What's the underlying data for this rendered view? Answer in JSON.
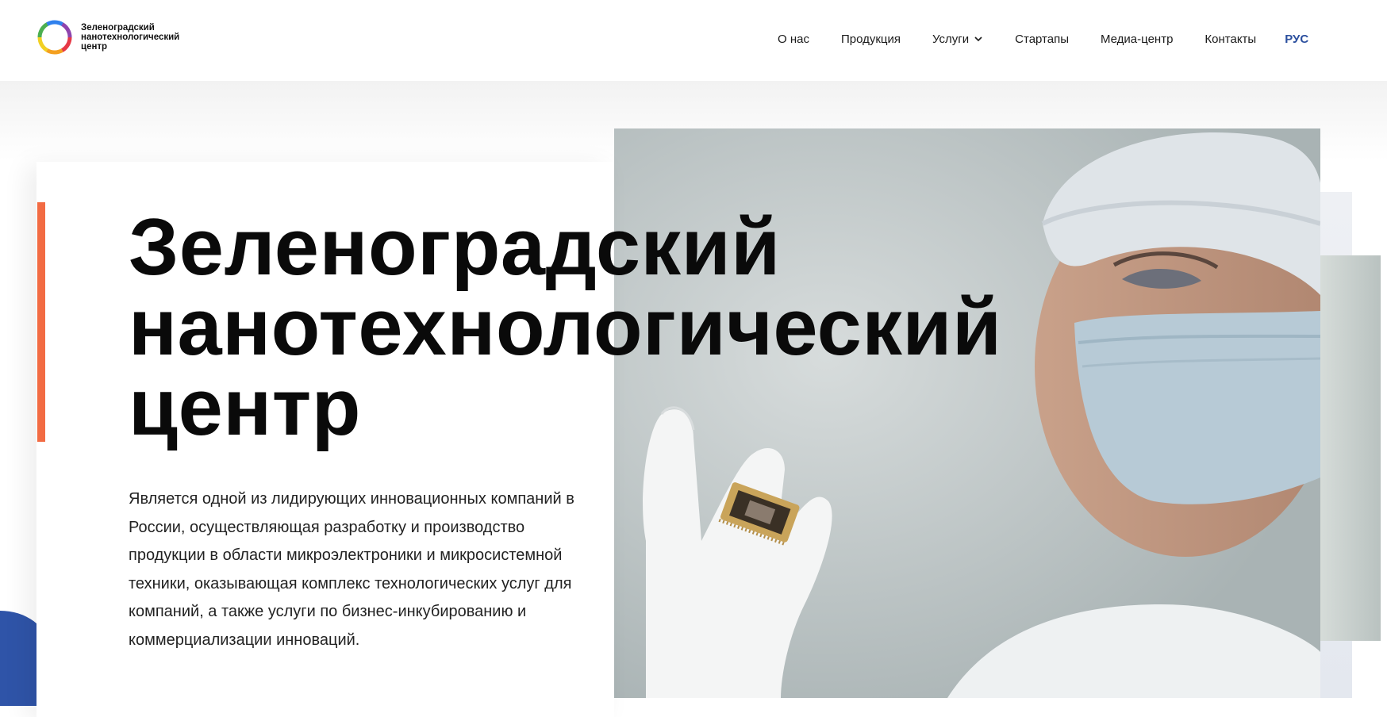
{
  "header": {
    "logo": {
      "text": "Зеленоградский нанотехнологический центр",
      "icon": "rainbow-ring-logo"
    },
    "nav": {
      "items": [
        {
          "label": "О нас"
        },
        {
          "label": "Продукция"
        },
        {
          "label": "Услуги",
          "has_dropdown": true
        },
        {
          "label": "Стартапы"
        },
        {
          "label": "Медиа-центр"
        },
        {
          "label": "Контакты"
        }
      ],
      "language": "РУС"
    }
  },
  "hero": {
    "title": "Зеленоградский\nнанотехнологический\nцентр",
    "description": "Является одной из лидирующих инновационных компаний в России, осуществляющая разработку и производство продукции в области микроэлектроники и микросистемной техники, оказывающая комплекс технологических услуг для компаний, а также услуги по бизнес-инкубированию и коммерциализации инноваций.",
    "image": "scientist-holding-microchip-photo"
  },
  "colors": {
    "accent": "#f26b43",
    "brand_blue": "#2f54a8",
    "language_link": "#2b4f9e"
  }
}
